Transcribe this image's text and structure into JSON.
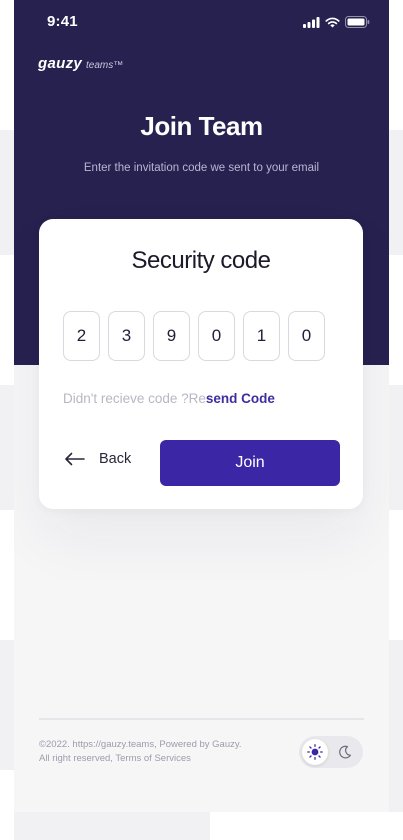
{
  "status_bar": {
    "time": "9:41"
  },
  "brand": {
    "name": "gauzy",
    "product": "teams™"
  },
  "header": {
    "title": "Join Team",
    "subtitle": "Enter the invitation code we sent to your email"
  },
  "card": {
    "title": "Security code",
    "code_digits": [
      "2",
      "3",
      "9",
      "0",
      "1",
      "0"
    ],
    "resend_prefix": "Didn't recieve code ?Re",
    "resend_link": "send Code",
    "back_label": "Back",
    "join_label": "Join"
  },
  "footer": {
    "line1": "©2022. https://gauzy.teams, Powered by Gauzy.",
    "line2": "All right reserved, Terms of Services"
  },
  "theme_toggle": {
    "selected": "light",
    "options": [
      "sun-icon",
      "moon-icon"
    ]
  },
  "colors": {
    "header_bg": "#27214f",
    "accent": "#3b26a6",
    "link": "#3d2ea0"
  }
}
